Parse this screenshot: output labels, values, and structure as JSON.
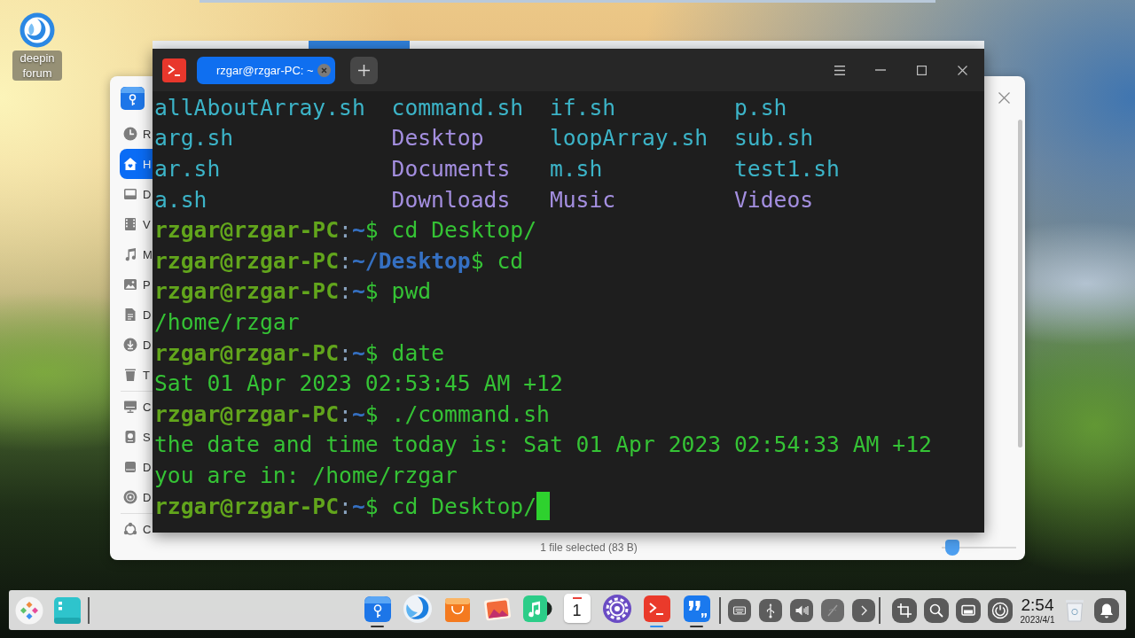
{
  "desktop": {
    "icons": [
      {
        "label": "deepin forum"
      }
    ]
  },
  "file_manager": {
    "sidebar": {
      "sections": [
        {
          "items": [
            {
              "label": "R",
              "selected": false
            },
            {
              "label": "H",
              "selected": true
            },
            {
              "label": "D",
              "selected": false
            },
            {
              "label": "V",
              "selected": false
            },
            {
              "label": "M",
              "selected": false
            },
            {
              "label": "P",
              "selected": false
            },
            {
              "label": "D",
              "selected": false
            },
            {
              "label": "D",
              "selected": false
            },
            {
              "label": "T",
              "selected": false
            }
          ]
        },
        {
          "items": [
            {
              "label": "C",
              "selected": false
            },
            {
              "label": "S",
              "selected": false
            },
            {
              "label": "D",
              "selected": false
            },
            {
              "label": "D",
              "selected": false
            }
          ]
        },
        {
          "items": [
            {
              "label": "C",
              "selected": false
            }
          ]
        }
      ]
    },
    "status": "1 file selected (83 B)",
    "zoom_slider": {
      "level": 0.06
    }
  },
  "terminal": {
    "tabs": [
      {
        "title": "rzgar@rzgar-PC: ~",
        "selected": true
      }
    ],
    "lines": [
      {
        "kind": "listing",
        "entries": [
          {
            "name": "allAboutArray.sh",
            "kind": "file"
          },
          {
            "name": "command.sh",
            "kind": "file"
          },
          {
            "name": "if.sh",
            "kind": "file"
          },
          {
            "name": "p.sh",
            "kind": "file"
          }
        ]
      },
      {
        "kind": "listing",
        "entries": [
          {
            "name": "arg.sh",
            "kind": "file"
          },
          {
            "name": "Desktop",
            "kind": "directory"
          },
          {
            "name": "loopArray.sh",
            "kind": "file"
          },
          {
            "name": "sub.sh",
            "kind": "file"
          }
        ]
      },
      {
        "kind": "listing",
        "entries": [
          {
            "name": "ar.sh",
            "kind": "file"
          },
          {
            "name": "Documents",
            "kind": "directory"
          },
          {
            "name": "m.sh",
            "kind": "file"
          },
          {
            "name": "test1.sh",
            "kind": "file"
          }
        ]
      },
      {
        "kind": "listing",
        "entries": [
          {
            "name": "a.sh",
            "kind": "file"
          },
          {
            "name": "Downloads",
            "kind": "directory"
          },
          {
            "name": "Music",
            "kind": "directory"
          },
          {
            "name": "Videos",
            "kind": "directory"
          }
        ]
      },
      {
        "kind": "prompt",
        "segments": [
          {
            "kind": "user",
            "text": "rzgar@rzgar-PC"
          },
          {
            "kind": "separator",
            "text": ":"
          },
          {
            "kind": "path",
            "text": "~"
          },
          {
            "kind": "plain",
            "text": "$ cd Desktop/"
          }
        ],
        "cursor": false
      },
      {
        "kind": "prompt",
        "segments": [
          {
            "kind": "user",
            "text": "rzgar@rzgar-PC"
          },
          {
            "kind": "separator",
            "text": ":"
          },
          {
            "kind": "path",
            "text": "~/Desktop"
          },
          {
            "kind": "plain",
            "text": "$ cd"
          }
        ],
        "cursor": false
      },
      {
        "kind": "prompt",
        "segments": [
          {
            "kind": "user",
            "text": "rzgar@rzgar-PC"
          },
          {
            "kind": "separator",
            "text": ":"
          },
          {
            "kind": "path",
            "text": "~"
          },
          {
            "kind": "plain",
            "text": "$ pwd"
          }
        ],
        "cursor": false
      },
      {
        "kind": "output",
        "text": "/home/rzgar"
      },
      {
        "kind": "prompt",
        "segments": [
          {
            "kind": "user",
            "text": "rzgar@rzgar-PC"
          },
          {
            "kind": "separator",
            "text": ":"
          },
          {
            "kind": "path",
            "text": "~"
          },
          {
            "kind": "plain",
            "text": "$ date"
          }
        ],
        "cursor": false
      },
      {
        "kind": "output",
        "text": "Sat 01 Apr 2023 02:53:45 AM +12"
      },
      {
        "kind": "prompt",
        "segments": [
          {
            "kind": "user",
            "text": "rzgar@rzgar-PC"
          },
          {
            "kind": "separator",
            "text": ":"
          },
          {
            "kind": "path",
            "text": "~"
          },
          {
            "kind": "plain",
            "text": "$ ./command.sh"
          }
        ],
        "cursor": false
      },
      {
        "kind": "output",
        "text": "the date and time today is: Sat 01 Apr 2023 02:54:33 AM +12"
      },
      {
        "kind": "output",
        "text": "you are in: /home/rzgar"
      },
      {
        "kind": "prompt",
        "segments": [
          {
            "kind": "user",
            "text": "rzgar@rzgar-PC"
          },
          {
            "kind": "separator",
            "text": ":"
          },
          {
            "kind": "path",
            "text": "~"
          },
          {
            "kind": "plain",
            "text": "$ cd Desktop/"
          }
        ],
        "cursor": true
      }
    ]
  },
  "dock": {
    "apps": [
      {
        "running": true,
        "focused": false
      },
      {
        "running": false,
        "focused": false
      },
      {
        "running": false,
        "focused": false
      },
      {
        "running": false,
        "focused": false
      },
      {
        "running": false,
        "focused": false
      },
      {
        "day": "1",
        "running": false,
        "focused": false
      },
      {
        "running": false,
        "focused": false
      },
      {
        "running": true,
        "focused": true
      },
      {
        "running": true,
        "focused": false
      }
    ],
    "clock": {
      "time": "2:54",
      "date": "2023/4/1"
    }
  }
}
